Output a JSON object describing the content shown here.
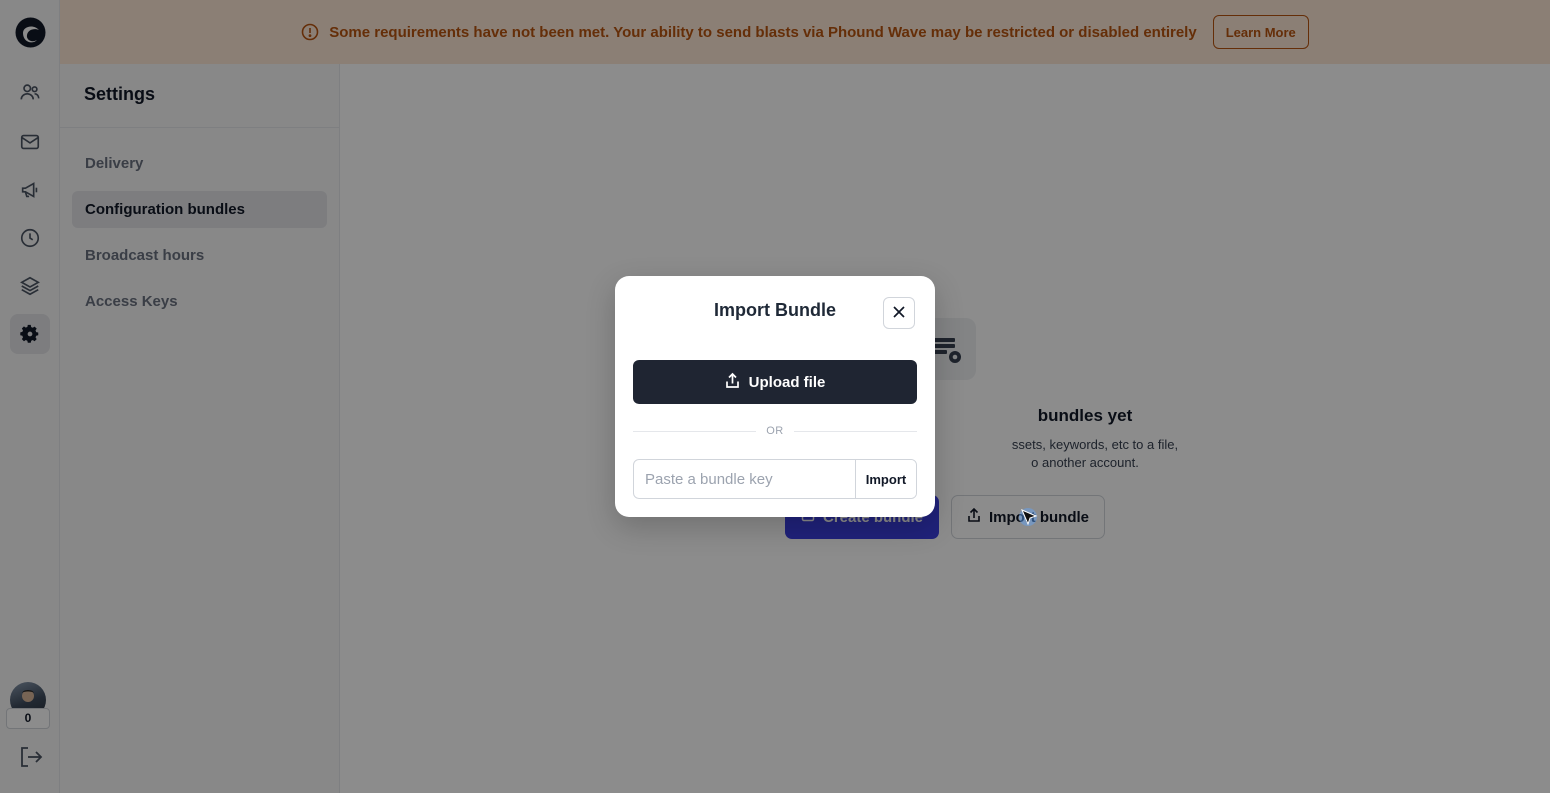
{
  "banner": {
    "message": "Some requirements have not been met. Your ability to send blasts via Phound Wave may be restricted or disabled entirely",
    "learn_more_label": "Learn More",
    "color": "#b8540f"
  },
  "rail": {
    "icons": [
      "logo-icon",
      "contacts-icon",
      "mail-icon",
      "megaphone-icon",
      "clock-icon",
      "layers-icon",
      "gear-icon"
    ],
    "credit_count": "0",
    "logout_icon": "logout-icon"
  },
  "settings": {
    "title": "Settings",
    "items": [
      {
        "label": "Delivery",
        "active": false
      },
      {
        "label": "Configuration bundles",
        "active": true
      },
      {
        "label": "Broadcast hours",
        "active": false
      },
      {
        "label": "Access Keys",
        "active": false
      }
    ]
  },
  "empty_state": {
    "title_visible": "bundles yet",
    "desc_line1_visible": "ssets, keywords, etc to a file,",
    "desc_line2_visible": "o another account.",
    "create_label": "Create bundle",
    "import_label": "Import bundle",
    "accent": "#3b3fe0"
  },
  "modal": {
    "title": "Import Bundle",
    "upload_label": "Upload file",
    "or_label": "OR",
    "key_placeholder": "Paste a bundle key",
    "import_label": "Import"
  }
}
